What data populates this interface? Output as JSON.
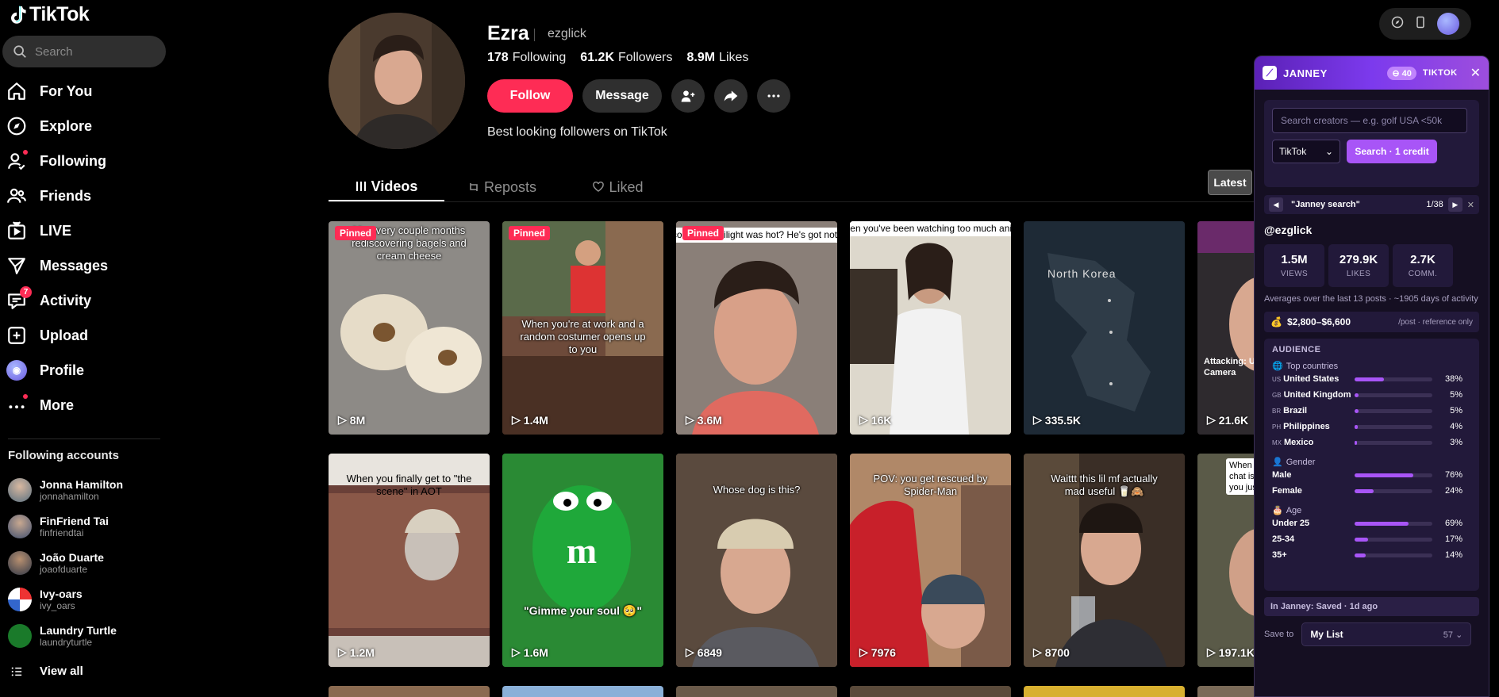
{
  "app": {
    "logo_text": "TikTok"
  },
  "search": {
    "placeholder": "Search"
  },
  "nav": [
    {
      "label": "For You",
      "icon": "home-icon"
    },
    {
      "label": "Explore",
      "icon": "compass-icon"
    },
    {
      "label": "Following",
      "icon": "user-follow-icon"
    },
    {
      "label": "Friends",
      "icon": "friends-icon"
    },
    {
      "label": "LIVE",
      "icon": "live-icon"
    },
    {
      "label": "Messages",
      "icon": "send-icon"
    },
    {
      "label": "Activity",
      "icon": "inbox-icon",
      "badge": "7"
    },
    {
      "label": "Upload",
      "icon": "plus-icon"
    },
    {
      "label": "Profile",
      "icon": "profile-avatar"
    },
    {
      "label": "More",
      "icon": "more-icon"
    }
  ],
  "following": {
    "title": "Following accounts",
    "accounts": [
      {
        "name": "Jonna Hamilton",
        "handle": "jonnahamilton"
      },
      {
        "name": "FinFriend Tai",
        "handle": "finfriendtai"
      },
      {
        "name": "João Duarte",
        "handle": "joaofduarte"
      },
      {
        "name": "Ivy-oars",
        "handle": "ivy_oars"
      },
      {
        "name": "Laundry Turtle",
        "handle": "laundryturtle"
      }
    ],
    "view_all": "View all"
  },
  "profile": {
    "name": "Ezra",
    "handle": "ezglick",
    "following_count": "178",
    "following_label": "Following",
    "followers_count": "61.2K",
    "followers_label": "Followers",
    "likes_count": "8.9M",
    "likes_label": "Likes",
    "follow_button": "Follow",
    "message_button": "Message",
    "bio": "Best looking followers on TikTok"
  },
  "tabs": [
    {
      "label": "Videos"
    },
    {
      "label": "Reposts"
    },
    {
      "label": "Liked"
    }
  ],
  "sort": {
    "latest": "Latest"
  },
  "videos": [
    {
      "views": "8M",
      "pinned": "Pinned",
      "caption": "Me every couple months rediscovering bagels and cream cheese",
      "bg": "#8d8a86"
    },
    {
      "views": "1.4M",
      "pinned": "Pinned",
      "caption": "When you're at work and a random costumer opens up to you",
      "bg": "#6d4a3a"
    },
    {
      "views": "3.6M",
      "pinned": "Pinned",
      "caption": "thought Jacob from Twilight was hot? He's got nothing on this mf",
      "bg": "#a07f6a"
    },
    {
      "views": "16K",
      "caption": "When you've been watching too much anime",
      "bg": "#9b8f7c"
    },
    {
      "views": "335.5K",
      "caption": "North Korea",
      "bg": "#1b2430"
    },
    {
      "views": "21.6K",
      "caption": "Attacking: Ultron Camera",
      "bg": "#3a3030"
    },
    {
      "views": "1.2M",
      "caption": "When you finally get to \"the scene\" in AOT",
      "bg": "#5a4540"
    },
    {
      "views": "1.6M",
      "caption": "\"Gimme your soul 🥺\"",
      "bg": "#1b7a2e"
    },
    {
      "views": "6849",
      "caption": "Whose dog is this?",
      "bg": "#6b5c4e"
    },
    {
      "views": "7976",
      "caption": "POV: you get rescued by Spider-Man",
      "bg": "#8a6a55"
    },
    {
      "views": "8700",
      "caption": "Waittt this lil mf actually mad useful 🥛🙈",
      "bg": "#4a3a30"
    },
    {
      "views": "197.1K",
      "caption": "When chat is you jus",
      "bg": "#4e5040"
    }
  ],
  "janney": {
    "brand": "JANNEY",
    "credits": "40",
    "platform_tag": "TIKTOK",
    "search_placeholder": "Search creators — e.g. golf USA <50k",
    "platform_value": "TikTok",
    "search_button": "Search · 1 credit",
    "nav_title": "\"Janney search\"",
    "nav_position": "1/38",
    "handle": "@ezglick",
    "metrics": [
      {
        "value": "1.5M",
        "label": "VIEWS"
      },
      {
        "value": "279.9K",
        "label": "LIKES"
      },
      {
        "value": "2.7K",
        "label": "COMM."
      }
    ],
    "note": "Averages over the last 13 posts · ~1905 days of activity",
    "price": "$2,800–$6,600",
    "price_note": "/post · reference only",
    "audience_title": "AUDIENCE",
    "countries_title": "Top countries",
    "countries": [
      {
        "code": "US",
        "name": "United States",
        "pct": "38%",
        "fill": 0.38
      },
      {
        "code": "GB",
        "name": "United Kingdom",
        "pct": "5%",
        "fill": 0.05
      },
      {
        "code": "BR",
        "name": "Brazil",
        "pct": "5%",
        "fill": 0.05
      },
      {
        "code": "PH",
        "name": "Philippines",
        "pct": "4%",
        "fill": 0.04
      },
      {
        "code": "MX",
        "name": "Mexico",
        "pct": "3%",
        "fill": 0.03
      }
    ],
    "gender_title": "Gender",
    "gender": [
      {
        "name": "Male",
        "pct": "76%",
        "fill": 0.76
      },
      {
        "name": "Female",
        "pct": "24%",
        "fill": 0.24
      }
    ],
    "age_title": "Age",
    "age": [
      {
        "name": "Under 25",
        "pct": "69%",
        "fill": 0.69
      },
      {
        "name": "25-34",
        "pct": "17%",
        "fill": 0.17
      },
      {
        "name": "35+",
        "pct": "14%",
        "fill": 0.14
      }
    ],
    "saved": "In Janney: Saved · 1d ago",
    "save_to_label": "Save to",
    "list_name": "My List",
    "list_count": "57"
  }
}
